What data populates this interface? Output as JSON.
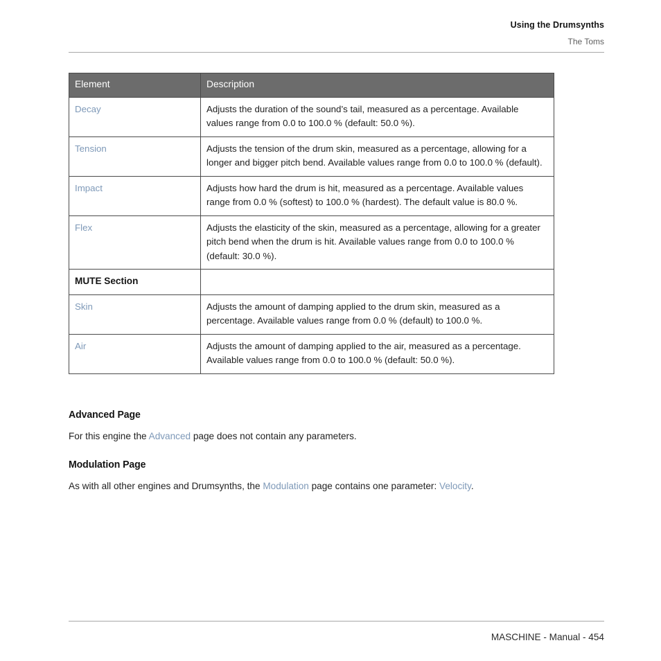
{
  "running_head": {
    "title": "Using the Drumsynths",
    "subtitle": "The Toms"
  },
  "table": {
    "columns": [
      "Element",
      "Description"
    ],
    "rows": [
      {
        "element": "Decay",
        "element_style": "link",
        "description": "Adjusts the duration of the sound’s tail, measured as a percentage. Available values range from 0.0 to 100.0 % (default: 50.0 %)."
      },
      {
        "element": "Tension",
        "element_style": "link",
        "description": "Adjusts the tension of the drum skin, measured as a percentage, allowing for a longer and bigger pitch bend. Available values range from 0.0 to 100.0 % (default)."
      },
      {
        "element": "Impact",
        "element_style": "link",
        "description": "Adjusts how hard the drum is hit, measured as a percentage. Available values range from 0.0 % (softest) to 100.0 % (hardest). The default value is 80.0 %."
      },
      {
        "element": "Flex",
        "element_style": "link",
        "description": "Adjusts the elasticity of the skin, measured as a percentage, allowing for a greater pitch bend when the drum is hit. Available values range from 0.0 to 100.0 % (default: 30.0 %)."
      },
      {
        "element": "MUTE Section",
        "element_style": "bold",
        "description": ""
      },
      {
        "element": "Skin",
        "element_style": "link",
        "description": "Adjusts the amount of damping applied to the drum skin, measured as a percentage. Available values range from 0.0 % (default) to 100.0 %."
      },
      {
        "element": "Air",
        "element_style": "link",
        "description": "Adjusts the amount of damping applied to the air, measured as a percentage. Available values range from 0.0 to 100.0 % (default: 50.0 %)."
      }
    ]
  },
  "sections": [
    {
      "heading": "Advanced Page",
      "paragraph_parts": [
        {
          "text": "For this engine the ",
          "style": "plain"
        },
        {
          "text": "Advanced",
          "style": "link"
        },
        {
          "text": " page does not contain any parameters.",
          "style": "plain"
        }
      ]
    },
    {
      "heading": "Modulation Page",
      "paragraph_parts": [
        {
          "text": "As with all other engines and Drumsynths, the ",
          "style": "plain"
        },
        {
          "text": "Modulation",
          "style": "link"
        },
        {
          "text": " page contains one parameter: ",
          "style": "plain"
        },
        {
          "text": "Velocity",
          "style": "link"
        },
        {
          "text": ".",
          "style": "plain"
        }
      ]
    }
  ],
  "footer": {
    "text": "MASCHINE - Manual - 454"
  },
  "colors": {
    "link": "#7e99b8",
    "table_header_bg": "#6c6c6c",
    "table_header_text": "#ffffff",
    "table_border": "#4a4a4a",
    "rule": "#a8a8a8",
    "body_text": "#1f1f1f"
  }
}
